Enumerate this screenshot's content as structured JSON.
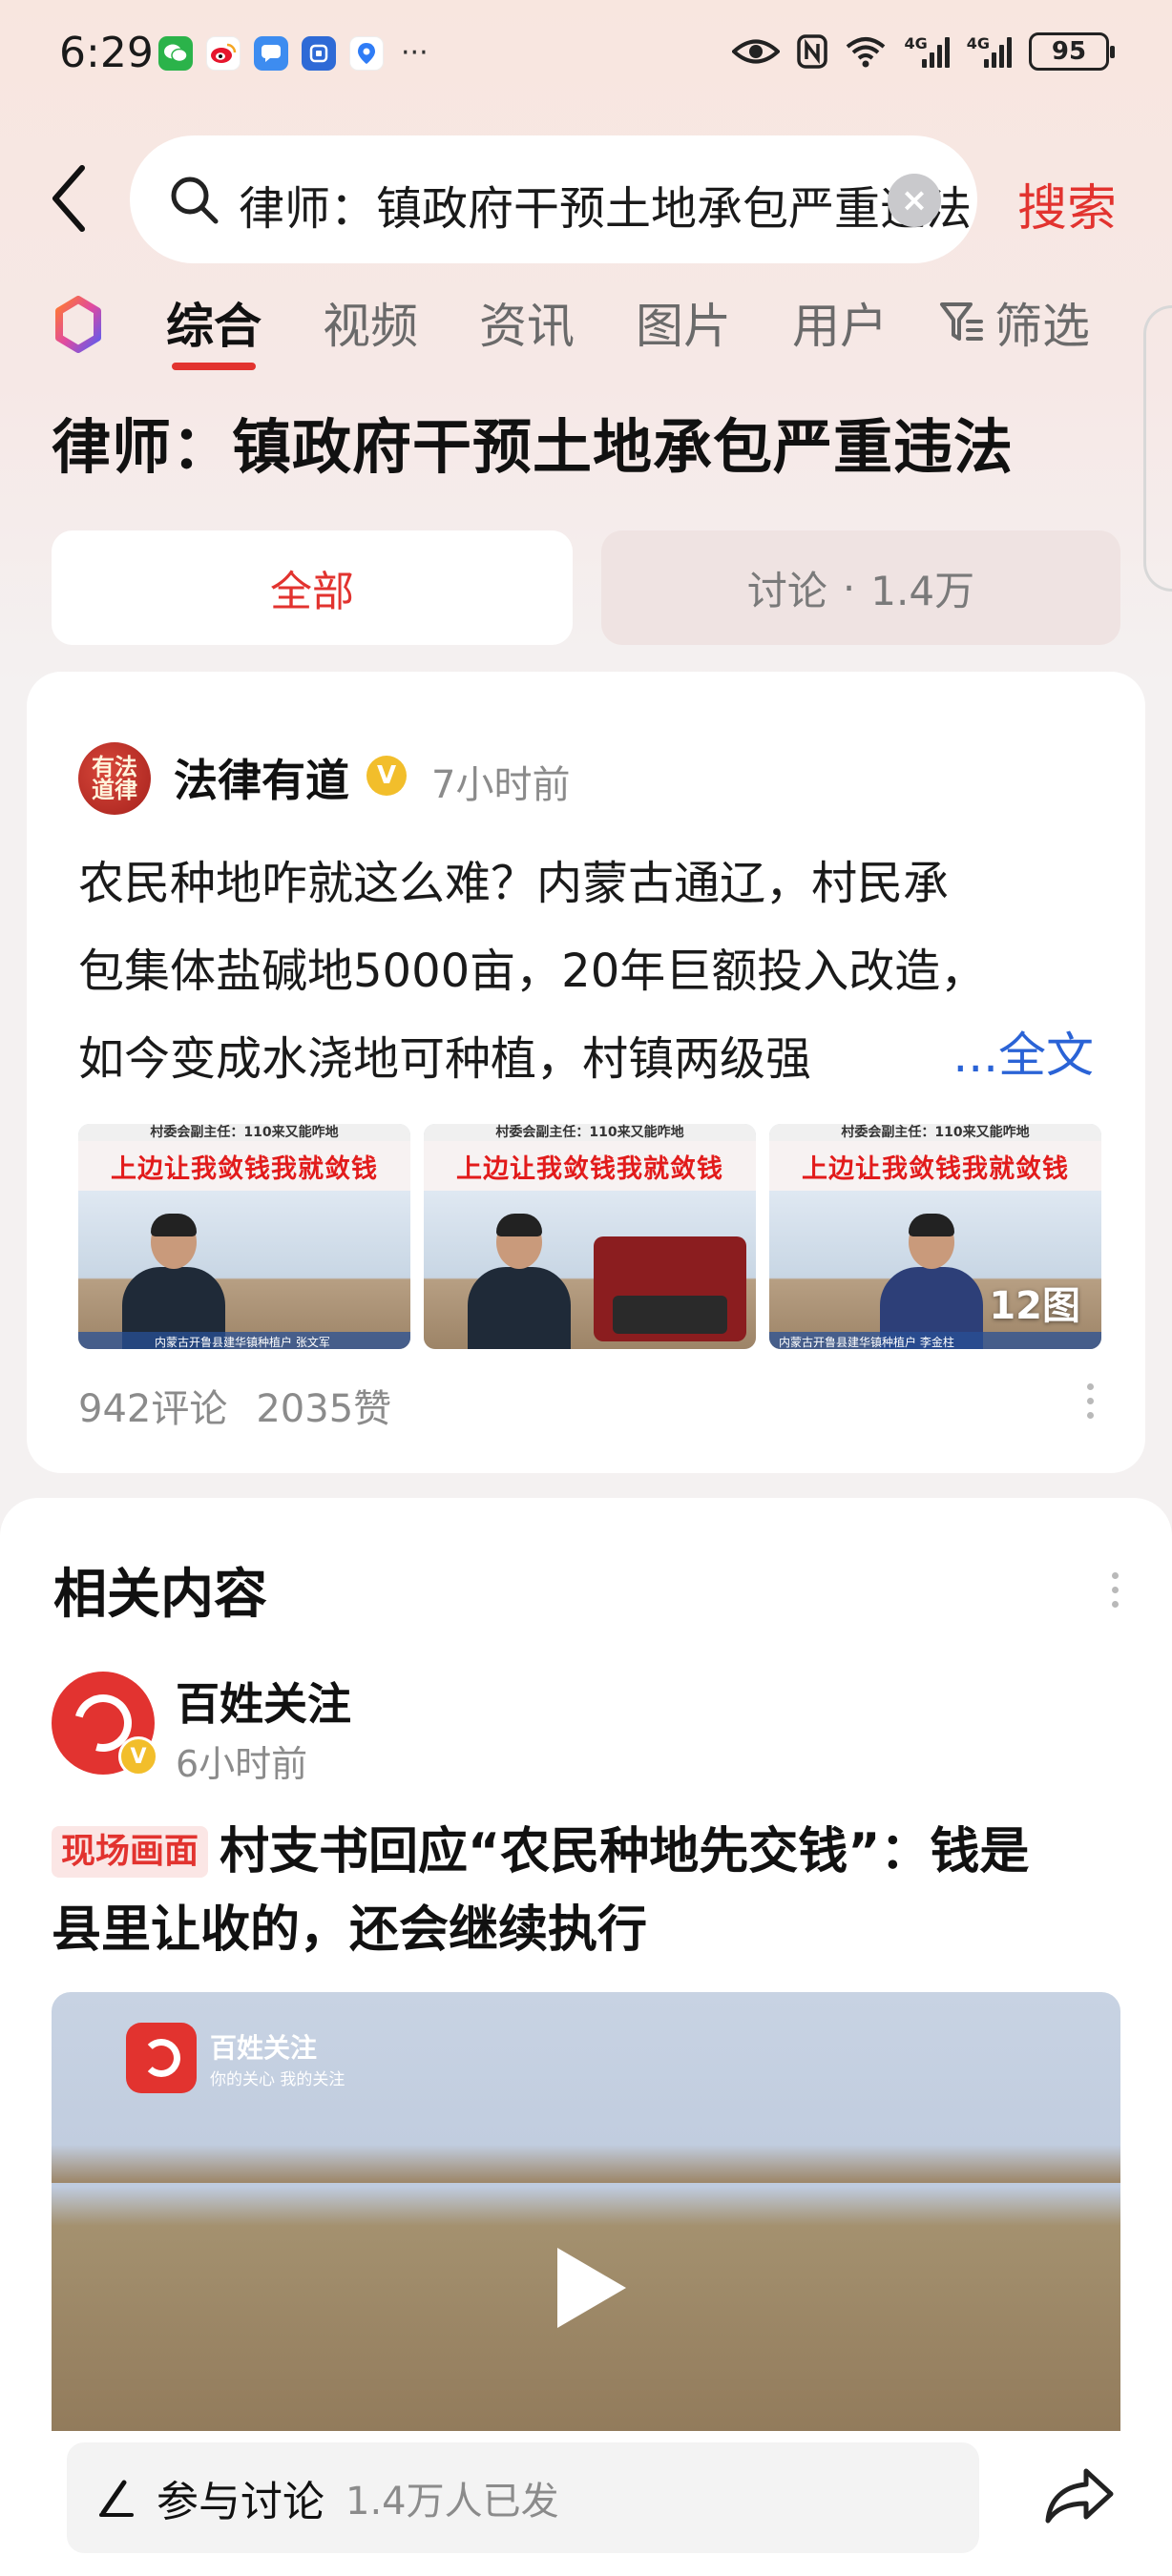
{
  "status_bar": {
    "time": "6:29",
    "battery": "95",
    "net_label_1": "4G",
    "net_label_2": "4G",
    "notification_icons": [
      "wechat-icon",
      "weibo-icon",
      "message-icon",
      "app-icon",
      "map-icon"
    ],
    "more": "···"
  },
  "search": {
    "query": "律师：镇政府干预土地承包严重违法",
    "clear": "×",
    "button_label": "搜索"
  },
  "tabs": [
    {
      "label": "综合",
      "active": true
    },
    {
      "label": "视频",
      "active": false
    },
    {
      "label": "资讯",
      "active": false
    },
    {
      "label": "图片",
      "active": false
    },
    {
      "label": "用户",
      "active": false
    }
  ],
  "filter_label": "筛选",
  "page_title": "律师：镇政府干预土地承包严重违法",
  "segments": {
    "all": "全部",
    "discuss": "讨论",
    "discuss_dot": "·",
    "discuss_count": "1.4万"
  },
  "post": {
    "avatar_text": "有法道律",
    "author": "法律有道",
    "verified": "V",
    "time": "7小时前",
    "body_lines": [
      "农民种地咋就这么难？内蒙古通辽，村民承",
      "包集体盐碱地5000亩，20年巨额投入改造，",
      "如今变成水浇地可种植，村镇两级强"
    ],
    "full_text": "...全文",
    "thumbs": [
      {
        "caption_top": "村委会副主任：110来又能咋地",
        "caption_red": "上边让我敛钱我就敛钱",
        "lower": "内蒙古开鲁县建华镇种植户 张文军"
      },
      {
        "caption_top": "村委会副主任：110来又能咋地",
        "caption_red": "上边让我敛钱我就敛钱",
        "lower": ""
      },
      {
        "caption_top": "村委会副主任：110来又能咋地",
        "caption_red": "上边让我敛钱我就敛钱",
        "lower": "内蒙古开鲁县建华镇种植户 李金柱"
      }
    ],
    "image_count": "12图",
    "comments": "942评论",
    "likes": "2035赞"
  },
  "related": {
    "section_title": "相关内容",
    "author": "百姓关注",
    "verified": "V",
    "time": "6小时前",
    "tag": "现场画面",
    "headline_line1": "村支书回应“农民种地先交钱”：钱是",
    "headline_line2": "县里让收的，还会继续执行",
    "video_logo_name": "百姓关注",
    "video_logo_slogan": "你的关心 我的关注"
  },
  "bottom_bar": {
    "discuss_label": "参与讨论",
    "discuss_count": "1.4万人已发"
  },
  "colors": {
    "accent": "#e2332f",
    "link": "#2a63d6",
    "verified": "#f2be2b"
  }
}
